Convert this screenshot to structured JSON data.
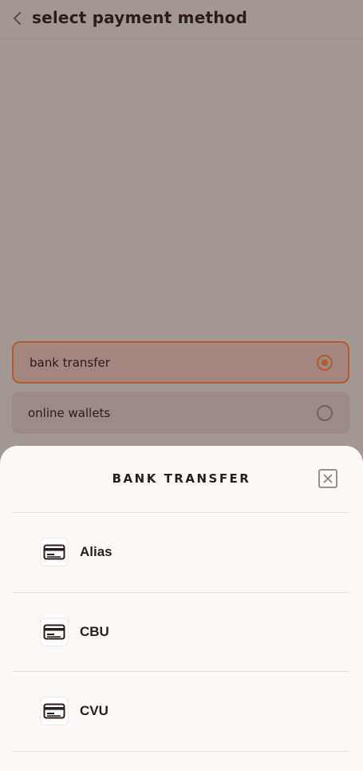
{
  "header": {
    "title": "select payment method"
  },
  "options": [
    {
      "label": "bank transfer",
      "selected": true
    },
    {
      "label": "online wallets",
      "selected": false
    }
  ],
  "sheet": {
    "title": "BANK TRANSFER",
    "items": [
      {
        "label": "Alias"
      },
      {
        "label": "CBU"
      },
      {
        "label": "CVU"
      }
    ]
  },
  "colors": {
    "accent": "#b45a2f",
    "text": "#2a1d1b",
    "sheet_bg": "#fdf9f6"
  }
}
